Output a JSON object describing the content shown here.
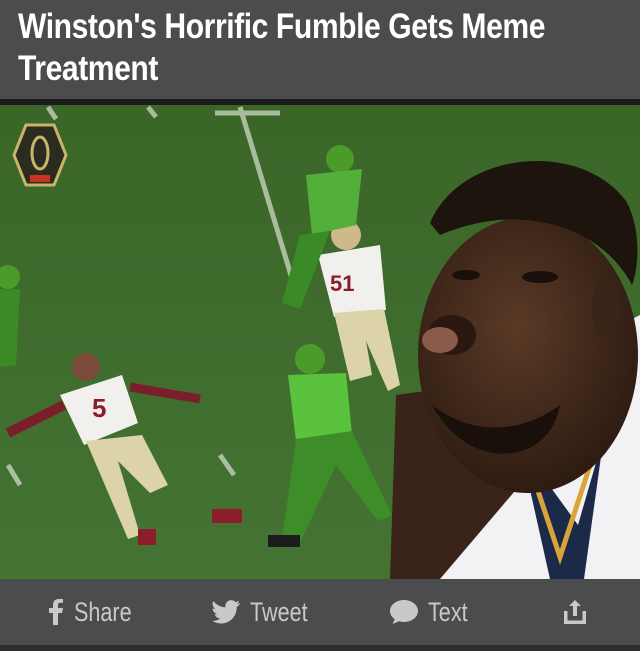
{
  "header": {
    "title": "Winston's Horrific Fumble Gets Meme Treatment"
  },
  "media": {
    "jersey_numbers": [
      "5",
      "51"
    ]
  },
  "share_bar": {
    "share_label": "Share",
    "tweet_label": "Tweet",
    "text_label": "Text",
    "share_icon": "facebook-f-icon",
    "tweet_icon": "twitter-bird-icon",
    "text_icon": "speech-bubble-icon",
    "export_icon": "upload-icon"
  },
  "colors": {
    "header_bg": "#4b4c4e",
    "headline_text": "#ffffff",
    "share_text": "#c9c9c9",
    "field_green": "#3e6a2b"
  }
}
